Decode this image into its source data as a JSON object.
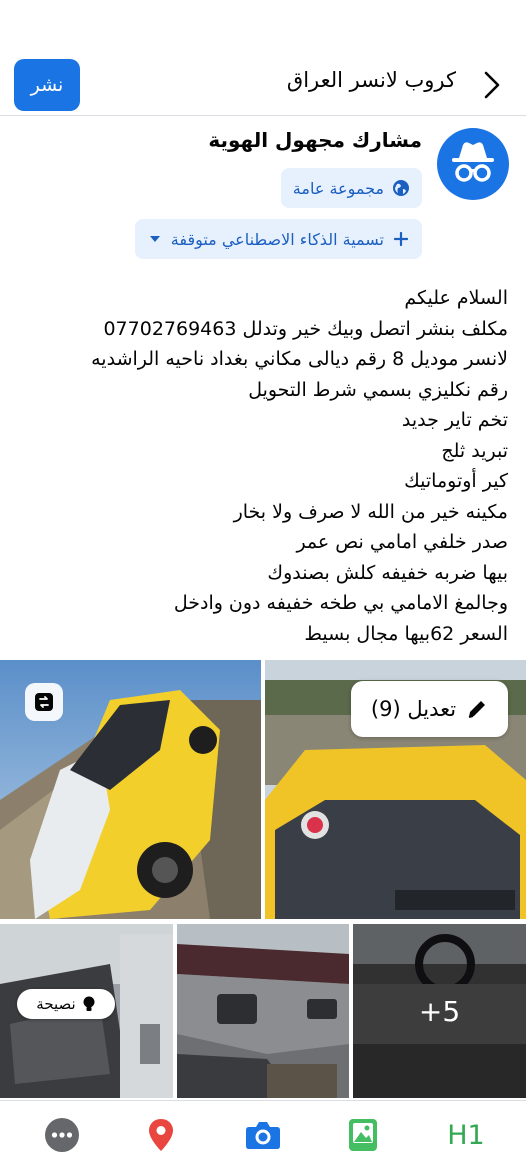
{
  "header": {
    "post_button": "نشر",
    "title": "كروب لانسر العراق"
  },
  "author": {
    "name": "مشارك مجهول الهوية",
    "audience": "مجموعة عامة",
    "ai_label": "تسمية الذكاء الاصطناعي متوقفة"
  },
  "post": {
    "lines": [
      "السلام عليكم",
      "مكلف بنشر اتصل وبيك خير وتدلل 07702769463",
      "لانسر موديل 8 رقم ديالى  مكاني بغداد ناحيه الراشديه",
      "رقم نكليزي بسمي شرط التحويل",
      "تخم تاير جديد",
      "تبريد ثلج",
      "كير أوتوماتيك",
      "مكينه خير من الله لا صرف ولا بخار",
      "صدر خلفي امامي نص عمر",
      "بيها ضربه خفيفه كلش بصندوك",
      "وجالمغ الامامي بي طخه خفيفه دون وادخل",
      "السعر 62بيها مجال بسيط"
    ]
  },
  "photos": {
    "edit_label": "تعديل (9)",
    "tip_label": "نصيحة",
    "more_count": "+5"
  },
  "toolbar": {
    "h1_label": "H1"
  },
  "colors": {
    "accent": "#1b74e4",
    "pill_bg": "#e7f0fd",
    "location": "#e9463f",
    "photo_green": "#45bd62",
    "h1_green": "#34a853"
  }
}
